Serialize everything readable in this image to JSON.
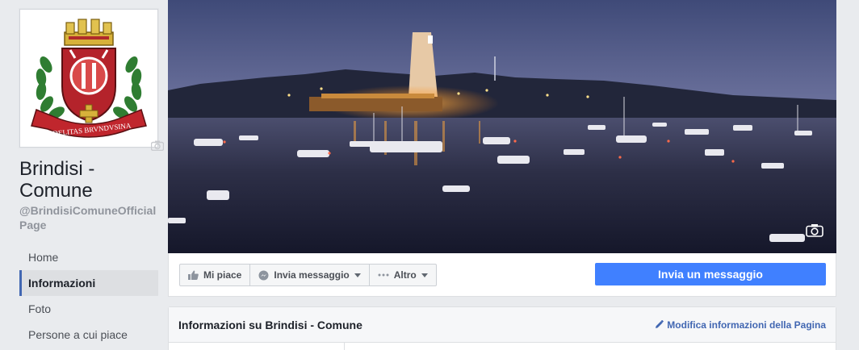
{
  "page": {
    "name": "Brindisi - Comune",
    "handle": "@BrindisiComuneOfficialPage",
    "logo_motto": "FIDELITAS BRVNDVSINA"
  },
  "nav": {
    "items": [
      {
        "label": "Home"
      },
      {
        "label": "Informazioni"
      },
      {
        "label": "Foto"
      },
      {
        "label": "Persone a cui piace"
      }
    ],
    "active_index": 1
  },
  "actions": {
    "like_label": "Mi piace",
    "message_label": "Invia messaggio",
    "more_label": "Altro",
    "primary_label": "Invia un messaggio"
  },
  "info": {
    "title": "Informazioni su Brindisi - Comune",
    "edit_label": "Modifica informazioni della Pagina"
  },
  "colors": {
    "brand_blue": "#4267b2",
    "primary_button": "#4080ff",
    "background": "#e9ebee"
  },
  "icons": {
    "like": "thumbs-up-icon",
    "message": "messenger-icon",
    "more": "ellipsis-icon",
    "edit": "pencil-icon",
    "camera": "camera-icon"
  }
}
